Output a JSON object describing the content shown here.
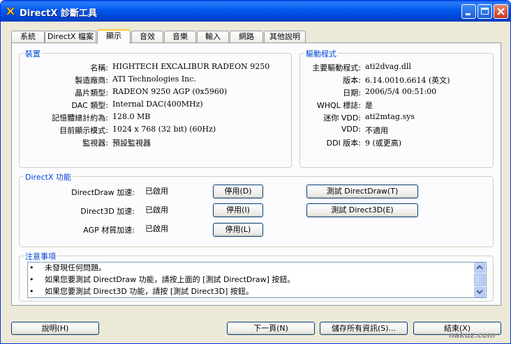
{
  "window": {
    "title": "DirectX 診斷工具"
  },
  "tabs": [
    {
      "label": "系統"
    },
    {
      "label": "DirectX 檔案"
    },
    {
      "label": "顯示"
    },
    {
      "label": "音效"
    },
    {
      "label": "音樂"
    },
    {
      "label": "輸入"
    },
    {
      "label": "網路"
    },
    {
      "label": "其他說明"
    }
  ],
  "device": {
    "title": "裝置",
    "rows": [
      {
        "label": "名稱:",
        "value": "HIGHTECH EXCALIBUR RADEON 9250"
      },
      {
        "label": "製造廠商:",
        "value": "ATI Technologies Inc."
      },
      {
        "label": "晶片類型:",
        "value": "RADEON 9250 AGP (0x5960)"
      },
      {
        "label": "DAC 類型:",
        "value": "Internal DAC(400MHz)"
      },
      {
        "label": "記憶體總計約為:",
        "value": "128.0 MB"
      },
      {
        "label": "目前顯示模式:",
        "value": "1024 x 768 (32 bit) (60Hz)"
      },
      {
        "label": "監視器:",
        "value": "預設監視器"
      }
    ]
  },
  "driver": {
    "title": "驅動程式",
    "rows": [
      {
        "label": "主要驅動程式:",
        "value": "ati2dvag.dll"
      },
      {
        "label": "版本:",
        "value": "6.14.0010.6614 (英文)"
      },
      {
        "label": "日期:",
        "value": "2006/5/4 00:51:00"
      },
      {
        "label": "WHQL 標誌:",
        "value": "是"
      },
      {
        "label": "迷你 VDD:",
        "value": "ati2mtag.sys"
      },
      {
        "label": "VDD:",
        "value": "不適用"
      },
      {
        "label": "DDI 版本:",
        "value": "9 (或更高)"
      }
    ]
  },
  "features": {
    "title": "DirectX 功能",
    "rows": [
      {
        "label": "DirectDraw 加速:",
        "status": "已啟用",
        "disable": "停用(D)",
        "test": "測試 DirectDraw(T)"
      },
      {
        "label": "Direct3D 加速:",
        "status": "已啟用",
        "disable": "停用(I)",
        "test": "測試 Direct3D(E)"
      },
      {
        "label": "AGP 材質加速:",
        "status": "已啟用",
        "disable": "停用(L)"
      }
    ]
  },
  "notes": {
    "title": "注意事項",
    "bullet": "•",
    "items": [
      "未發現任何問題。",
      "如果您要測試 DirectDraw 功能，請按上面的 [測試 DirectDraw] 按鈕。",
      "如果您要測試 Direct3D 功能，請按 [測試 Direct3D] 按鈕。"
    ]
  },
  "footer": {
    "help": "說明(H)",
    "next": "下一頁(N)",
    "save": "儲存所有資訊(S)...",
    "exit": "結束(X)"
  },
  "watermark": "nakuz.com"
}
